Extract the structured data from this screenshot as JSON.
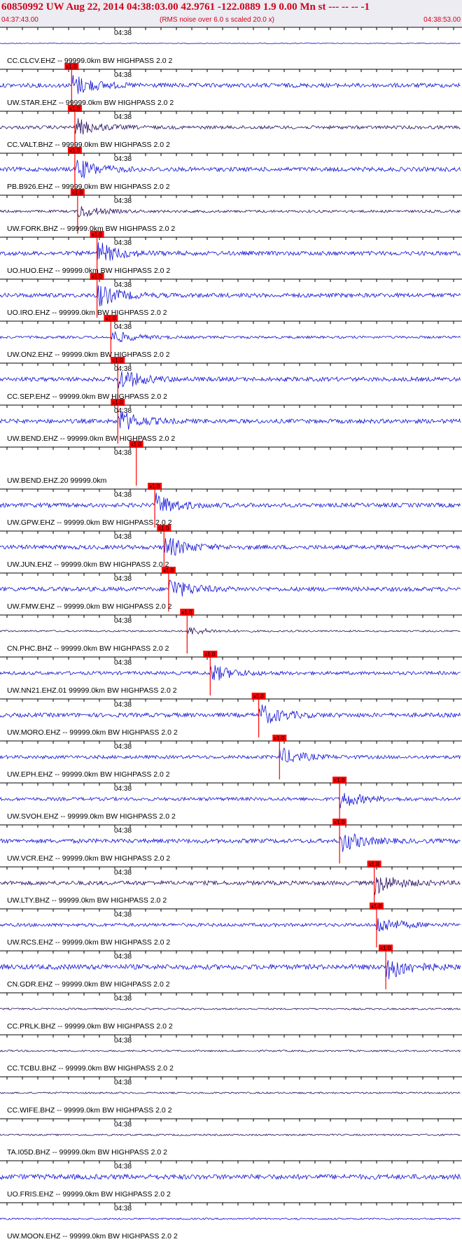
{
  "header": {
    "title": "60850992 UW Aug 22, 2014 04:38:03.00   42.9761 -122.0889  1.9 0.00 Mn st --- -- --   -1",
    "start_time": "04:37:43.00",
    "rms_note": "(RMS noise over 6.0 s scaled 20.0 x)",
    "end_time": "04:38:53.00"
  },
  "time_tick_label": "04:38",
  "marker_label": "x1.0",
  "colors": {
    "trace": "#1212d6",
    "trace_dark": "#2a1060",
    "pick": "#ff0000",
    "axis": "#000000",
    "header_text": "#d0021b"
  },
  "traces": [
    {
      "label": "CC.CLCV.EHZ -- 99999.0km BW  HIGHPASS  2.0  2",
      "pick": null,
      "amp": 1,
      "dark": false
    },
    {
      "label": "UW.STAR.EHZ -- 99999.0km BW  HIGHPASS  2.0  2",
      "pick": 0.155,
      "amp": 5,
      "dark": false
    },
    {
      "label": "CC.VALT.BHZ -- 99999.0km BW  HIGHPASS  2.0  2",
      "pick": 0.162,
      "amp": 4,
      "dark": true
    },
    {
      "label": "PB.B926.EHZ -- 99999.0km BW  HIGHPASS  2.0  2",
      "pick": 0.162,
      "amp": 5,
      "dark": false
    },
    {
      "label": "UW.FORK.BHZ -- 99999.0km BW  HIGHPASS  2.0  2",
      "pick": 0.168,
      "amp": 3,
      "dark": true
    },
    {
      "label": "UO.HUO.EHZ -- 99999.0km BW  HIGHPASS  2.0  2",
      "pick": 0.21,
      "amp": 5,
      "dark": false
    },
    {
      "label": "UO.IRO.EHZ -- 99999.0km BW  HIGHPASS  2.0  2",
      "pick": 0.21,
      "amp": 5,
      "dark": false
    },
    {
      "label": "UW.ON2.EHZ -- 99999.0km BW  HIGHPASS  2.0  2",
      "pick": 0.24,
      "amp": 3,
      "dark": false
    },
    {
      "label": "CC.SEP.EHZ -- 99999.0km BW  HIGHPASS  2.0  2",
      "pick": 0.255,
      "amp": 5,
      "dark": false
    },
    {
      "label": "UW.BEND.EHZ -- 99999.0km BW  HIGHPASS  2.0  2",
      "pick": 0.255,
      "amp": 5,
      "dark": false
    },
    {
      "label": "UW.BEND.EHZ.20 99999.0km",
      "pick": 0.295,
      "amp": 0,
      "dark": false
    },
    {
      "label": "UW.GPW.EHZ -- 99999.0km BW  HIGHPASS  2.0  2",
      "pick": 0.335,
      "amp": 5,
      "dark": false
    },
    {
      "label": "UW.JUN.EHZ -- 99999.0km BW  HIGHPASS  2.0  2",
      "pick": 0.355,
      "amp": 5,
      "dark": false
    },
    {
      "label": "UW.FMW.EHZ -- 99999.0km BW  HIGHPASS  2.0  2",
      "pick": 0.365,
      "amp": 5,
      "dark": false
    },
    {
      "label": "CN.PHC.BHZ -- 99999.0km BW  HIGHPASS  2.0  2",
      "pick": 0.405,
      "amp": 2,
      "dark": true
    },
    {
      "label": "UW.NN21.EHZ.01 99999.0km BW  HIGHPASS  2.0  2",
      "pick": 0.455,
      "amp": 4,
      "dark": false
    },
    {
      "label": "UW.MORO.EHZ -- 99999.0km BW  HIGHPASS  2.0  2",
      "pick": 0.56,
      "amp": 5,
      "dark": false
    },
    {
      "label": "UW.EPH.EHZ -- 99999.0km BW  HIGHPASS  2.0  2",
      "pick": 0.605,
      "amp": 4,
      "dark": false
    },
    {
      "label": "UW.SVOH.EHZ -- 99999.0km BW  HIGHPASS  2.0  2",
      "pick": 0.735,
      "amp": 4,
      "dark": false
    },
    {
      "label": "UW.VCR.EHZ -- 99999.0km BW  HIGHPASS  2.0  2",
      "pick": 0.735,
      "amp": 5,
      "dark": false
    },
    {
      "label": "UW.LTY.BHZ -- 99999.0km BW  HIGHPASS  2.0  2",
      "pick": 0.81,
      "amp": 5,
      "dark": true
    },
    {
      "label": "UW.RCS.EHZ -- 99999.0km BW  HIGHPASS  2.0  2",
      "pick": 0.815,
      "amp": 4,
      "dark": false
    },
    {
      "label": "CN.GDR.EHZ -- 99999.0km BW  HIGHPASS  2.0  2",
      "pick": 0.835,
      "amp": 6,
      "dark": false
    },
    {
      "label": "CC.PRLK.BHZ -- 99999.0km BW  HIGHPASS  2.0  2",
      "pick": null,
      "amp": 2,
      "dark": true
    },
    {
      "label": "CC.TCBU.BHZ -- 99999.0km BW  HIGHPASS  2.0  2",
      "pick": null,
      "amp": 2,
      "dark": true
    },
    {
      "label": "CC.WIFE.BHZ -- 99999.0km BW  HIGHPASS  2.0  2",
      "pick": null,
      "amp": 2,
      "dark": true
    },
    {
      "label": "TA.I05D.BHZ -- 99999.0km BW  HIGHPASS  2.0  2",
      "pick": null,
      "amp": 2,
      "dark": true
    },
    {
      "label": "UO.FRIS.EHZ -- 99999.0km BW  HIGHPASS  2.0  2",
      "pick": null,
      "amp": 6,
      "dark": false
    },
    {
      "label": "UW.MOON.EHZ -- 99999.0km BW  HIGHPASS  2.0  2",
      "pick": null,
      "amp": 2,
      "dark": false
    }
  ]
}
